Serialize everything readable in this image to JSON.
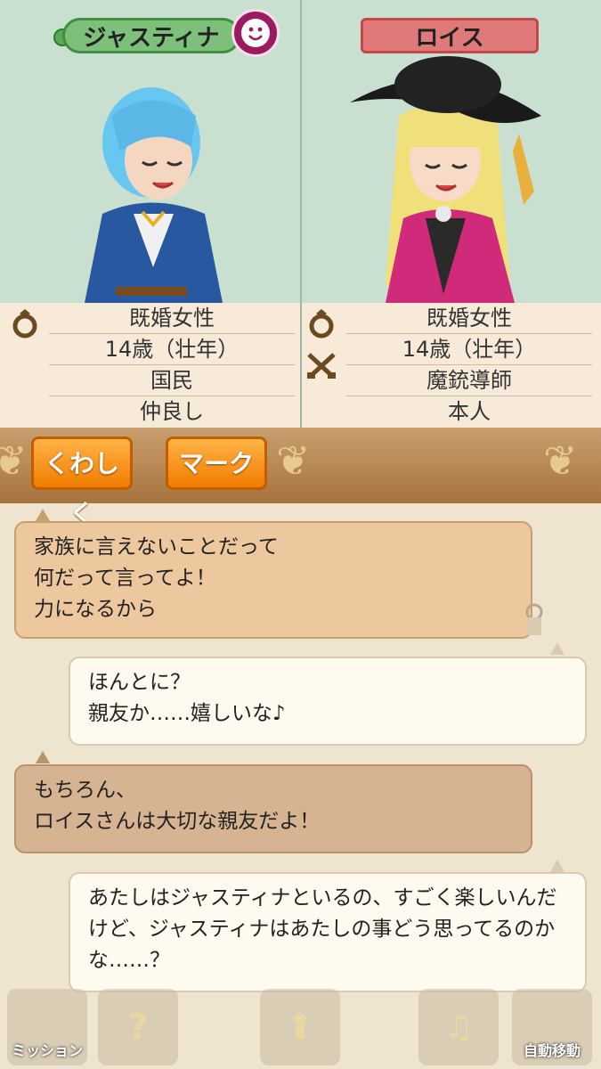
{
  "characters": {
    "left": {
      "name": "ジャスティナ",
      "info": [
        "既婚女性",
        "14歳（壮年）",
        "国民",
        "仲良し"
      ]
    },
    "right": {
      "name": "ロイス",
      "info": [
        "既婚女性",
        "14歳（壮年）",
        "魔銃導師",
        "本人"
      ]
    }
  },
  "buttons": {
    "detail": "くわしく",
    "mark": "マーク"
  },
  "messages": [
    {
      "side": "left",
      "text": "家族に言えないことだって\n何だって言ってよ！\n力になるから"
    },
    {
      "side": "right",
      "text": "ほんとに？\n親友か……嬉しいな♪"
    },
    {
      "side": "left",
      "text": "もちろん、\nロイスさんは大切な親友だよ！"
    },
    {
      "side": "right",
      "text": "あたしはジャスティナといるの、すごく楽しいんだけど、ジャスティナはあたしの事どう思ってるのかな……？"
    }
  ],
  "bottom_nav": {
    "mission": "ミッション",
    "auto_move": "自動移動"
  },
  "colors": {
    "button_orange": "#f07d00",
    "name_left": "#7cc07c",
    "name_right": "#e07a7a",
    "mood_badge": "#9e1a60"
  }
}
